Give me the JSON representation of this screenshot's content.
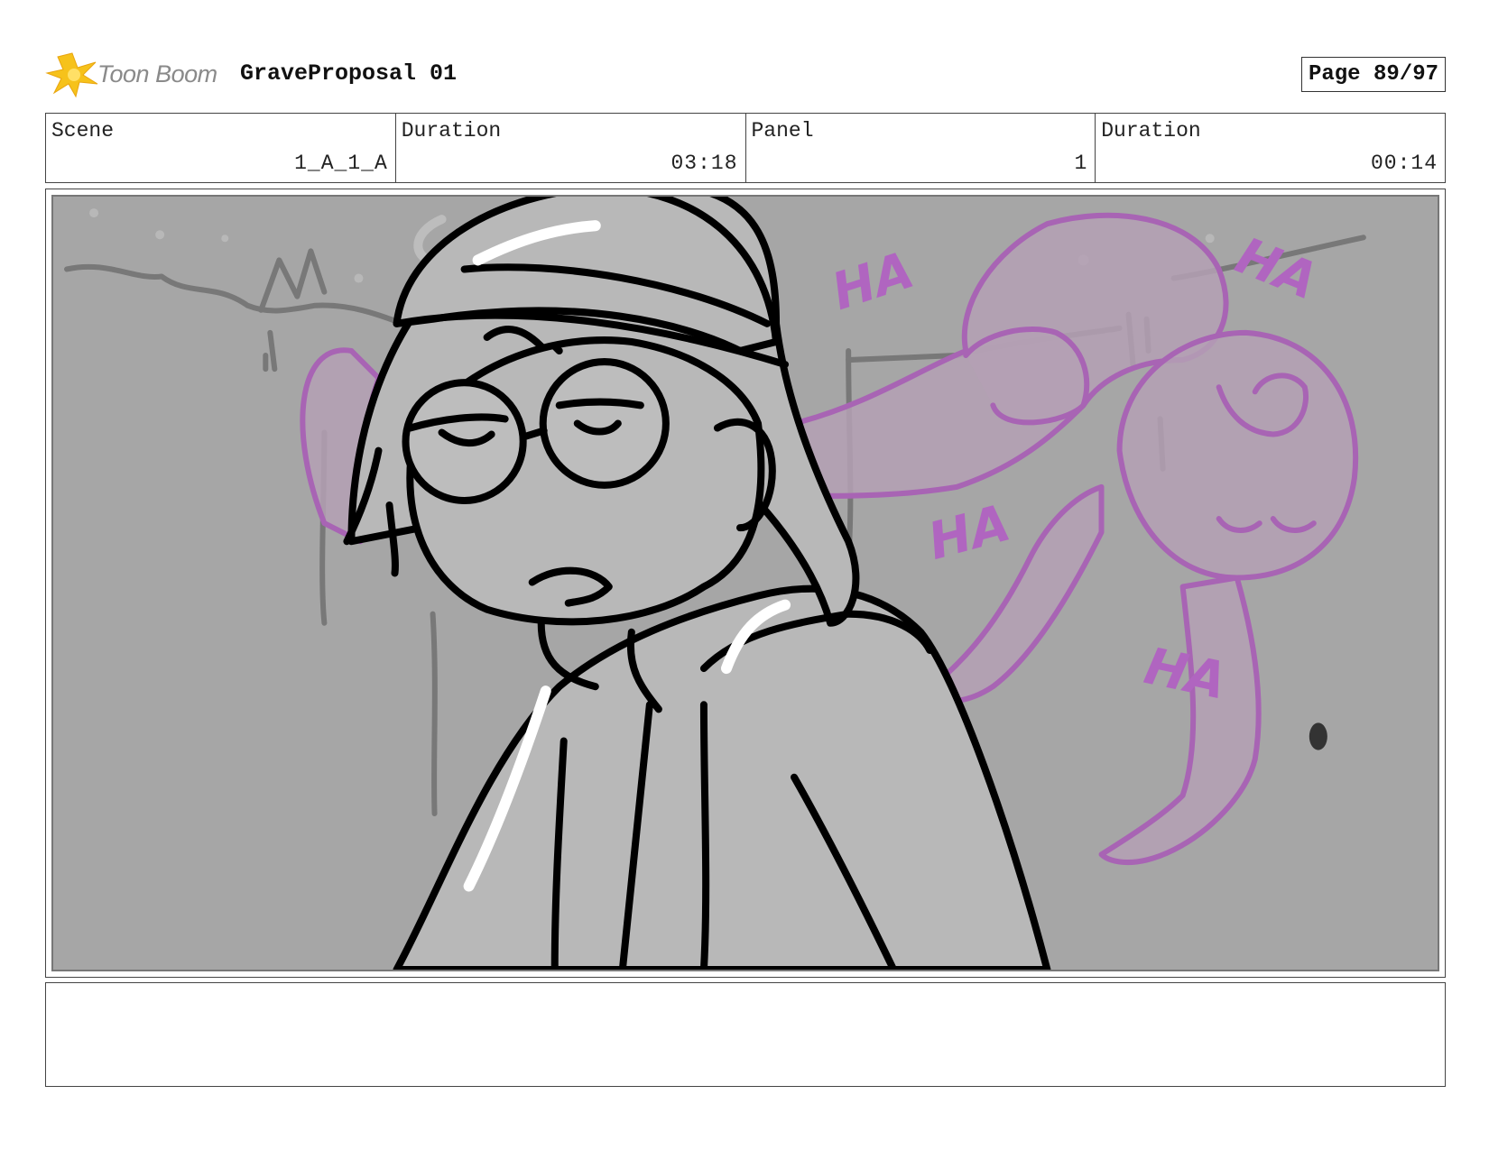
{
  "header": {
    "logo_text": "Toon Boom",
    "project_title": "GraveProposal 01",
    "page_indicator": "Page 89/97"
  },
  "info": [
    {
      "label": "Scene",
      "value": "1_A_1_A"
    },
    {
      "label": "Duration",
      "value": "03:18"
    },
    {
      "label": "Panel",
      "value": "1"
    },
    {
      "label": "Duration",
      "value": "00:14"
    }
  ],
  "panel": {
    "sfx": [
      "HA",
      "HA",
      "HA",
      "HA"
    ],
    "colors": {
      "background": "#a6a6a6",
      "character_fill": "#b8b8b8",
      "ghost_line": "#a864b4",
      "ghost_fill": "#b4a0b4"
    }
  },
  "notes": {
    "text": ""
  }
}
